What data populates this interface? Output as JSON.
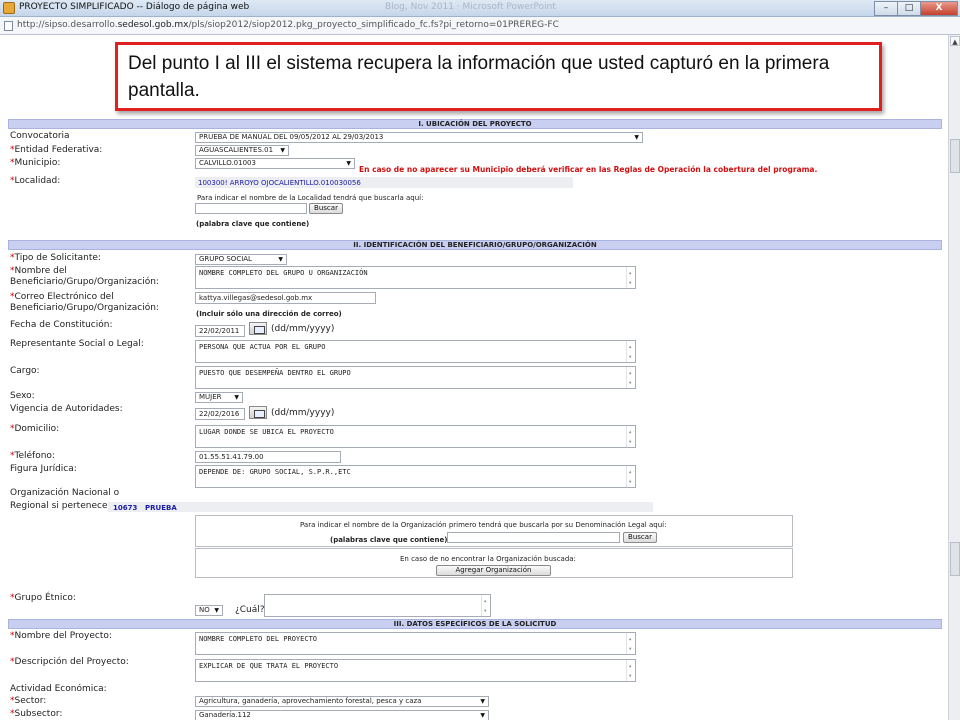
{
  "window": {
    "title": "PROYECTO SIMPLIFICADO -- Diálogo de página web",
    "title_ghost": "Blog, Nov 2011 · Microsoft PowerPoint",
    "minimize": "–",
    "maximize": "□",
    "close": "X"
  },
  "address": {
    "url_prefix": "http://sipso.desarrollo.",
    "url_domain": "sedesol.gob.mx",
    "url_suffix": "/pls/siop2012/siop2012.pkg_proyecto_simplificado_fc.fs?pi_retorno=01PREREG-FC"
  },
  "callout": {
    "text": "Del punto I al III el sistema  recupera la información que usted capturó en la primera pantalla."
  },
  "sections": {
    "s1": "I. UBICACIÓN DEL PROYECTO",
    "s2": "II. IDENTIFICACIÓN DEL BENEFICIARIO/GRUPO/ORGANIZACIÓN",
    "s3": "III. DATOS ESPECÍFICOS DE LA SOLICITUD"
  },
  "required_mark": "*",
  "fields": {
    "convocatoria": {
      "label": "Convocatoria",
      "value": "PRUEBA DE MANUAL DEL 09/05/2012 AL 29/03/2013"
    },
    "entidad": {
      "label": "Entidad Federativa:",
      "value": "AGUASCALIENTES.01"
    },
    "municipio": {
      "label": "Municipio:",
      "value": "CALVILLO.01003",
      "warning": "En caso de no aparecer su Municipio deberá verificar en las Reglas de Operación la cobertura del programa."
    },
    "localidad": {
      "label": "Localidad:",
      "value": "100300! ARROYO OJOCALIENTILLO.010030056",
      "hint": "Para indicar el nombre de la Localidad tendrá que buscarla aquí:",
      "search_button": "Buscar",
      "keyword_note": "(palabra clave que contiene)"
    },
    "tipo_solicitante": {
      "label": "Tipo de Solicitante:",
      "value": "GRUPO SOCIAL"
    },
    "nombre_beneficiario": {
      "label_line1": "Nombre del",
      "label_line2": "Beneficiario/Grupo/Organización:",
      "value": "NOMBRE COMPLETO DEL GRUPO U ORGANIZACIÓN"
    },
    "correo": {
      "label_line1": "Correo Electrónico del",
      "label_line2": "Beneficiario/Grupo/Organización:",
      "value": "kattya.villegas@sedesol.gob.mx",
      "note": "(Incluir sólo una dirección de correo)"
    },
    "fecha_constitucion": {
      "label": "Fecha de Constitución:",
      "value": "22/02/2011",
      "format": "(dd/mm/yyyy)"
    },
    "representante": {
      "label": "Representante Social o Legal:",
      "value": "PERSONA QUE ACTUA POR EL GRUPO"
    },
    "cargo": {
      "label": "Cargo:",
      "value": "PUESTO QUE DESEMPEÑA DENTRO EL GRUPO"
    },
    "sexo": {
      "label": "Sexo:",
      "value": "MUJER"
    },
    "vigencia": {
      "label": "Vigencia de Autoridades:",
      "value": "22/02/2016",
      "format": "(dd/mm/yyyy)"
    },
    "domicilio": {
      "label": "Domicilio:",
      "value": "LUGAR DONDE SE UBICA EL PROYECTO"
    },
    "telefono": {
      "label": "Teléfono:",
      "value": "01.55.51.41.79.00"
    },
    "figura_juridica": {
      "label": "Figura Jurídica:",
      "value": "DEPENDE DE: GRUPO SOCIAL, S.P.R.,ETC"
    },
    "organizacion": {
      "label_line1": "Organización Nacional o",
      "label_line2": "Regional si pertenece:",
      "code": "10673",
      "name": "PRUEBA",
      "search_hint": "Para indicar el nombre de la Organización primero tendrá que buscarla por su Denominación Legal aquí:",
      "keyword_note": "(palabras clave que contiene)",
      "search_button": "Buscar",
      "not_found": "En caso de no encontrar la Organización buscada:",
      "add_button": "Agregar Organización"
    },
    "grupo_etnico": {
      "label": "Grupo Étnico:",
      "value": "NO",
      "which": "¿Cuál?"
    },
    "nombre_proyecto": {
      "label": "Nombre del Proyecto:",
      "value": "NOMBRE COMPLETO DEL PROYECTO"
    },
    "descripcion": {
      "label": "Descripción del Proyecto:",
      "value": "EXPLICAR DE QUE TRATA EL PROYECTO"
    },
    "actividad": {
      "label": "Actividad Económica:"
    },
    "sector": {
      "label": "Sector:",
      "value": "Agricultura, ganadería, aprovechamiento forestal, pesca y caza"
    },
    "subsector": {
      "label": "Subsector:",
      "value": "Ganadería.112"
    }
  }
}
